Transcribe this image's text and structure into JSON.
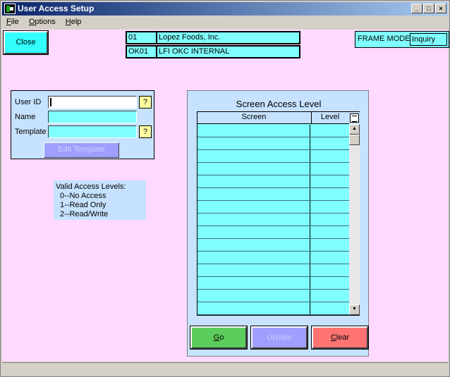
{
  "window": {
    "title": "User Access Setup",
    "controls": {
      "minimize": "_",
      "maximize": "□",
      "close": "×"
    }
  },
  "menu": [
    {
      "label": "File",
      "accel": "F",
      "rest": "ile"
    },
    {
      "label": "Options",
      "accel": "O",
      "rest": "ptions"
    },
    {
      "label": "Help",
      "accel": "H",
      "rest": "elp"
    }
  ],
  "toolbar": {
    "close_label": "Close"
  },
  "company": {
    "code": "01",
    "name": "Lopez Foods, Inc.",
    "location_code": "OK01",
    "location_name": "LFI OKC INTERNAL"
  },
  "frame_mode": {
    "label": "FRAME MODE",
    "value": "Inquiry"
  },
  "user_form": {
    "user_id_label": "User ID",
    "user_id_value": "",
    "name_label": "Name",
    "name_value": "",
    "template_label": "Template",
    "template_value": "",
    "help_glyph": "?",
    "edit_template_label": "Edit Template"
  },
  "access_levels": {
    "heading": "Valid Access Levels:",
    "items": [
      "0--No Access",
      "1--Read Only",
      "2--Read/Write"
    ]
  },
  "screen_access": {
    "title": "Screen Access Level",
    "columns": [
      "Screen",
      "Level"
    ],
    "rows": [
      [
        "",
        ""
      ],
      [
        "",
        ""
      ],
      [
        "",
        ""
      ],
      [
        "",
        ""
      ],
      [
        "",
        ""
      ],
      [
        "",
        ""
      ],
      [
        "",
        ""
      ],
      [
        "",
        ""
      ],
      [
        "",
        ""
      ],
      [
        "",
        ""
      ],
      [
        "",
        ""
      ],
      [
        "",
        ""
      ],
      [
        "",
        ""
      ],
      [
        "",
        ""
      ],
      [
        "",
        ""
      ]
    ]
  },
  "actions": {
    "go": {
      "accel": "G",
      "rest": "o"
    },
    "update": "Update",
    "clear": {
      "accel": "C",
      "rest": "lear"
    }
  },
  "colors": {
    "client_bg": "#ffd9ff",
    "field_cyan": "#80ffff",
    "panel_blue": "#c6e2ff",
    "go_green": "#5ccd5c",
    "clear_red": "#ff7373",
    "disabled_purple": "#9f9fff"
  }
}
